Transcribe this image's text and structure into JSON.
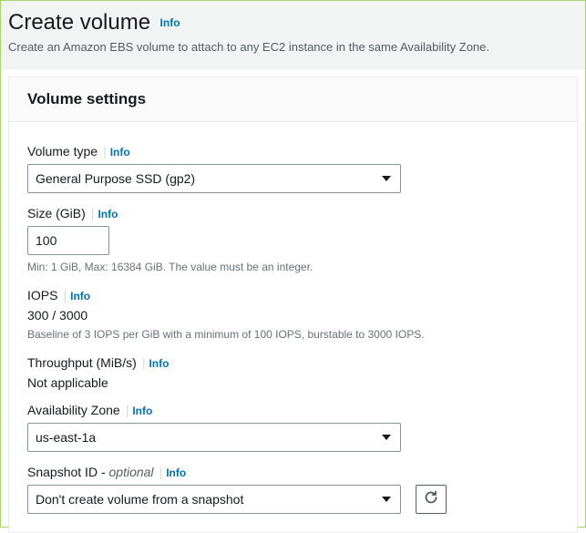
{
  "header": {
    "title": "Create volume",
    "info_label": "Info",
    "subtitle": "Create an Amazon EBS volume to attach to any EC2 instance in the same Availability Zone."
  },
  "panel": {
    "title": "Volume settings"
  },
  "volume_type": {
    "label": "Volume type",
    "info": "Info",
    "value": "General Purpose SSD (gp2)"
  },
  "size": {
    "label": "Size (GiB)",
    "info": "Info",
    "value": "100",
    "hint": "Min: 1 GiB, Max: 16384 GiB. The value must be an integer."
  },
  "iops": {
    "label": "IOPS",
    "info": "Info",
    "value": "300 / 3000",
    "hint": "Baseline of 3 IOPS per GiB with a minimum of 100 IOPS, burstable to 3000 IOPS."
  },
  "throughput": {
    "label": "Throughput (MiB/s)",
    "info": "Info",
    "value": "Not applicable"
  },
  "az": {
    "label": "Availability Zone",
    "info": "Info",
    "value": "us-east-1a"
  },
  "snapshot": {
    "label": "Snapshot ID -",
    "optional": " optional",
    "info": "Info",
    "value": "Don't create volume from a snapshot"
  }
}
